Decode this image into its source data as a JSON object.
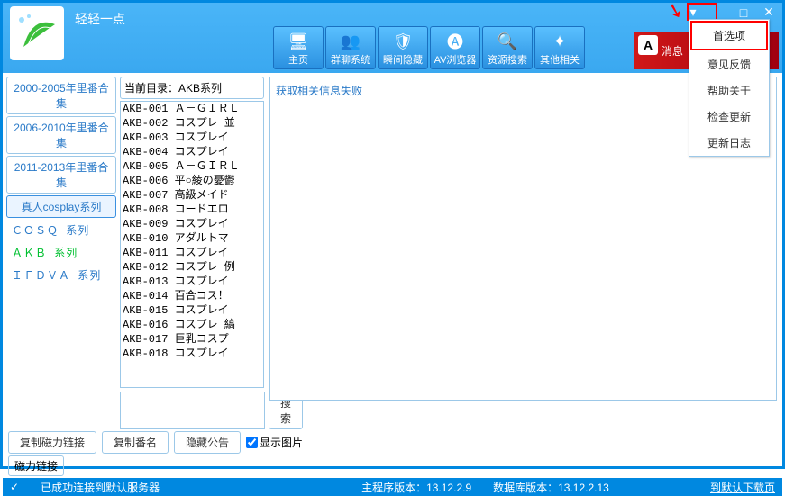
{
  "app_title": "轻轻一点",
  "window_controls": {
    "menu": "▾",
    "min": "—",
    "max": "□",
    "close": "✕"
  },
  "dropdown": {
    "preferences": "首选项",
    "feedback": "意见反馈",
    "help_about": "帮助关于",
    "check_update": "检查更新",
    "changelog": "更新日志"
  },
  "toolbar": {
    "home": "主页",
    "group": "群聊系统",
    "hide": "瞬间隐藏",
    "browser": "AV浏览器",
    "search": "资源搜索",
    "other": "其他相关"
  },
  "ad_text": "消息",
  "categories": {
    "c1": "2000-2005年里番合集",
    "c2": "2006-2010年里番合集",
    "c3": "2011-2013年里番合集",
    "c4": "真人cosplay系列",
    "s1": "ＣＯＳＱ 系列",
    "s2": "ＡＫＢ 系列",
    "s3": "ＩＦＤＶＡ 系列"
  },
  "current_dir_label": "当前目录：AKB系列",
  "files": [
    "AKB-001 Ａ－ＧＩＲＬ",
    "AKB-002 コスプレ 並",
    "AKB-003 コスプレイ",
    "AKB-004 コスプレイ",
    "AKB-005 Ａ－ＧＩＲＬ",
    "AKB-006 平○綾の憂鬱",
    "AKB-007 高級メイド",
    "AKB-008 コードエロ",
    "AKB-009 コスプレイ",
    "AKB-010 アダルトマ",
    "AKB-011 コスプレイ",
    "AKB-012 コスプレ 例",
    "AKB-013 コスプレイ",
    "AKB-014 百合コス！",
    "AKB-015 コスプレイ",
    "AKB-016 コスプレ 縞",
    "AKB-017 巨乳コスプ",
    "AKB-018 コスプレイ"
  ],
  "search_btn": "搜索",
  "bottom": {
    "copy_magnet": "复制磁力链接",
    "copy_name": "复制番名",
    "hide_notice": "隐藏公告",
    "show_image": "显示图片",
    "magnet_label": "磁力链接"
  },
  "info_panel": "获取相关信息失败",
  "status": {
    "connected": "已成功连接到默认服务器",
    "main_ver": "主程序版本：13.12.2.9",
    "db_ver": "数据库版本：13.12.2.13",
    "goto": "到默认下载页"
  }
}
